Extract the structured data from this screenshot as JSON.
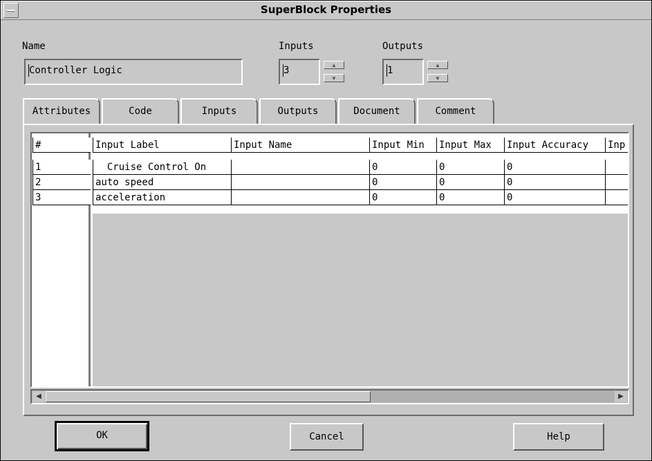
{
  "window": {
    "title": "SuperBlock Properties"
  },
  "name_field": {
    "label": "Name",
    "value": "Controller Logic"
  },
  "inputs_field": {
    "label": "Inputs",
    "value": "3"
  },
  "outputs_field": {
    "label": "Outputs",
    "value": "1"
  },
  "tabs": [
    {
      "label": "Attributes"
    },
    {
      "label": "Code"
    },
    {
      "label": "Inputs"
    },
    {
      "label": "Outputs"
    },
    {
      "label": "Document"
    },
    {
      "label": "Comment"
    }
  ],
  "table": {
    "columns": [
      "#",
      "Input Label",
      "Input Name",
      "Input Min",
      "Input Max",
      "Input Accuracy",
      "Inp"
    ],
    "rows": [
      [
        "1",
        "  Cruise Control On",
        "",
        "0",
        "0",
        "0",
        ""
      ],
      [
        "2",
        "auto speed",
        "",
        "0",
        "0",
        "0",
        ""
      ],
      [
        "3",
        "acceleration",
        "",
        "0",
        "0",
        "0",
        ""
      ]
    ]
  },
  "buttons": {
    "ok": "OK",
    "cancel": "Cancel",
    "help": "Help"
  }
}
